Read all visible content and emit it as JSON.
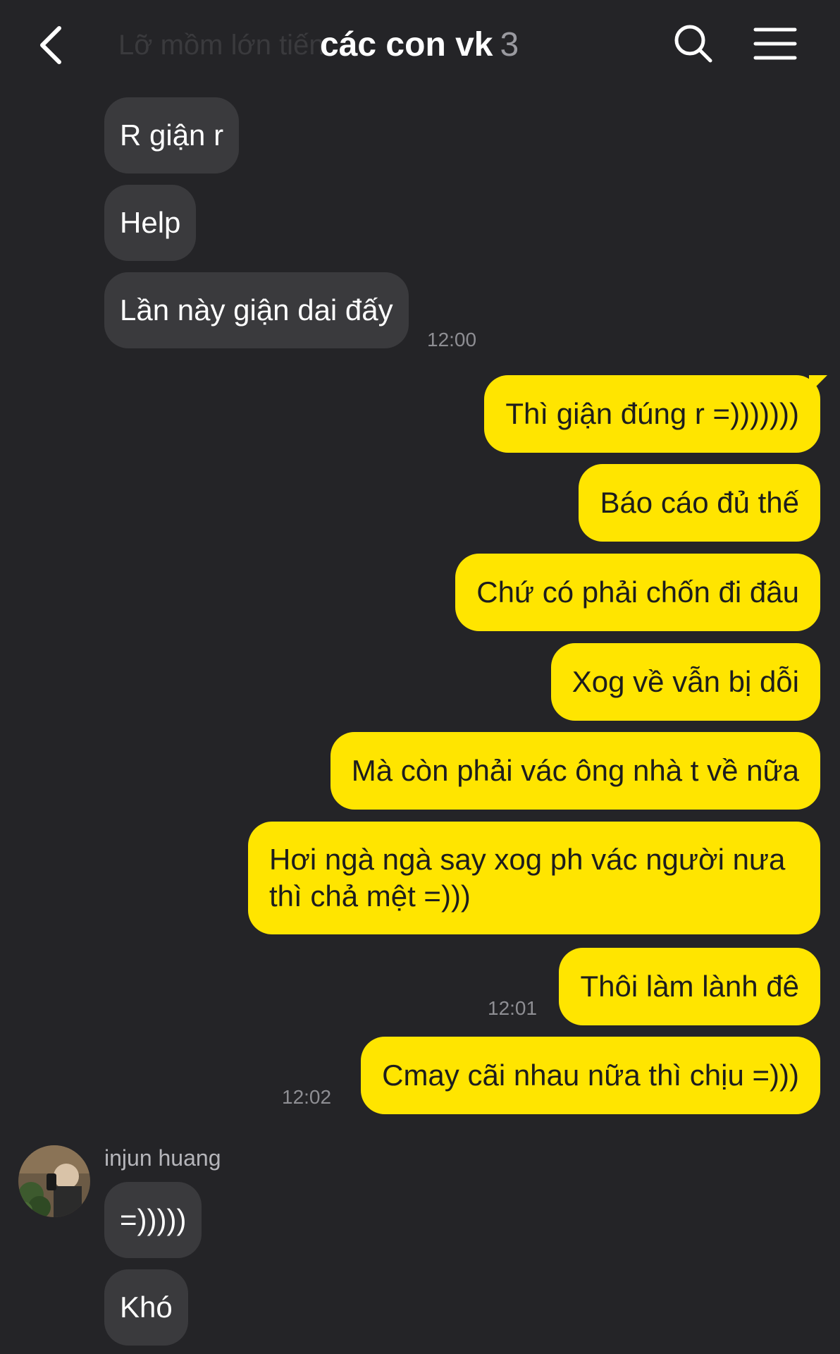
{
  "header": {
    "ghost_title": "Lỡ mồm lớn tiếng",
    "title": "các con vk",
    "member_count": "3"
  },
  "messages": {
    "m1": "R giận r",
    "m2": "Help",
    "m3": "Lần này giận dai đấy",
    "t1": "12:00",
    "o1": "Thì giận đúng r =)))))))",
    "o2": "Báo cáo đủ thế",
    "o3": "Chứ có phải chốn đi đâu",
    "o4": "Xog về vẫn bị dỗi",
    "o5": "Mà còn phải vác ông nhà t về nữa",
    "o6": "Hơi ngà ngà say xog ph vác người nưa thì chả mệt =)))",
    "o7": "Thôi làm lành đê",
    "t2": "12:01",
    "o8": "Cmay cãi nhau nữa thì chịu =)))",
    "t3": "12:02",
    "sender": "injun huang",
    "m4": "=)))))",
    "m5": "Khó"
  },
  "colors": {
    "background": "#242427",
    "incoming_bubble": "#3a3a3d",
    "outgoing_bubble": "#ffe500"
  },
  "icons": [
    "back-arrow-icon",
    "search-icon",
    "menu-icon"
  ]
}
